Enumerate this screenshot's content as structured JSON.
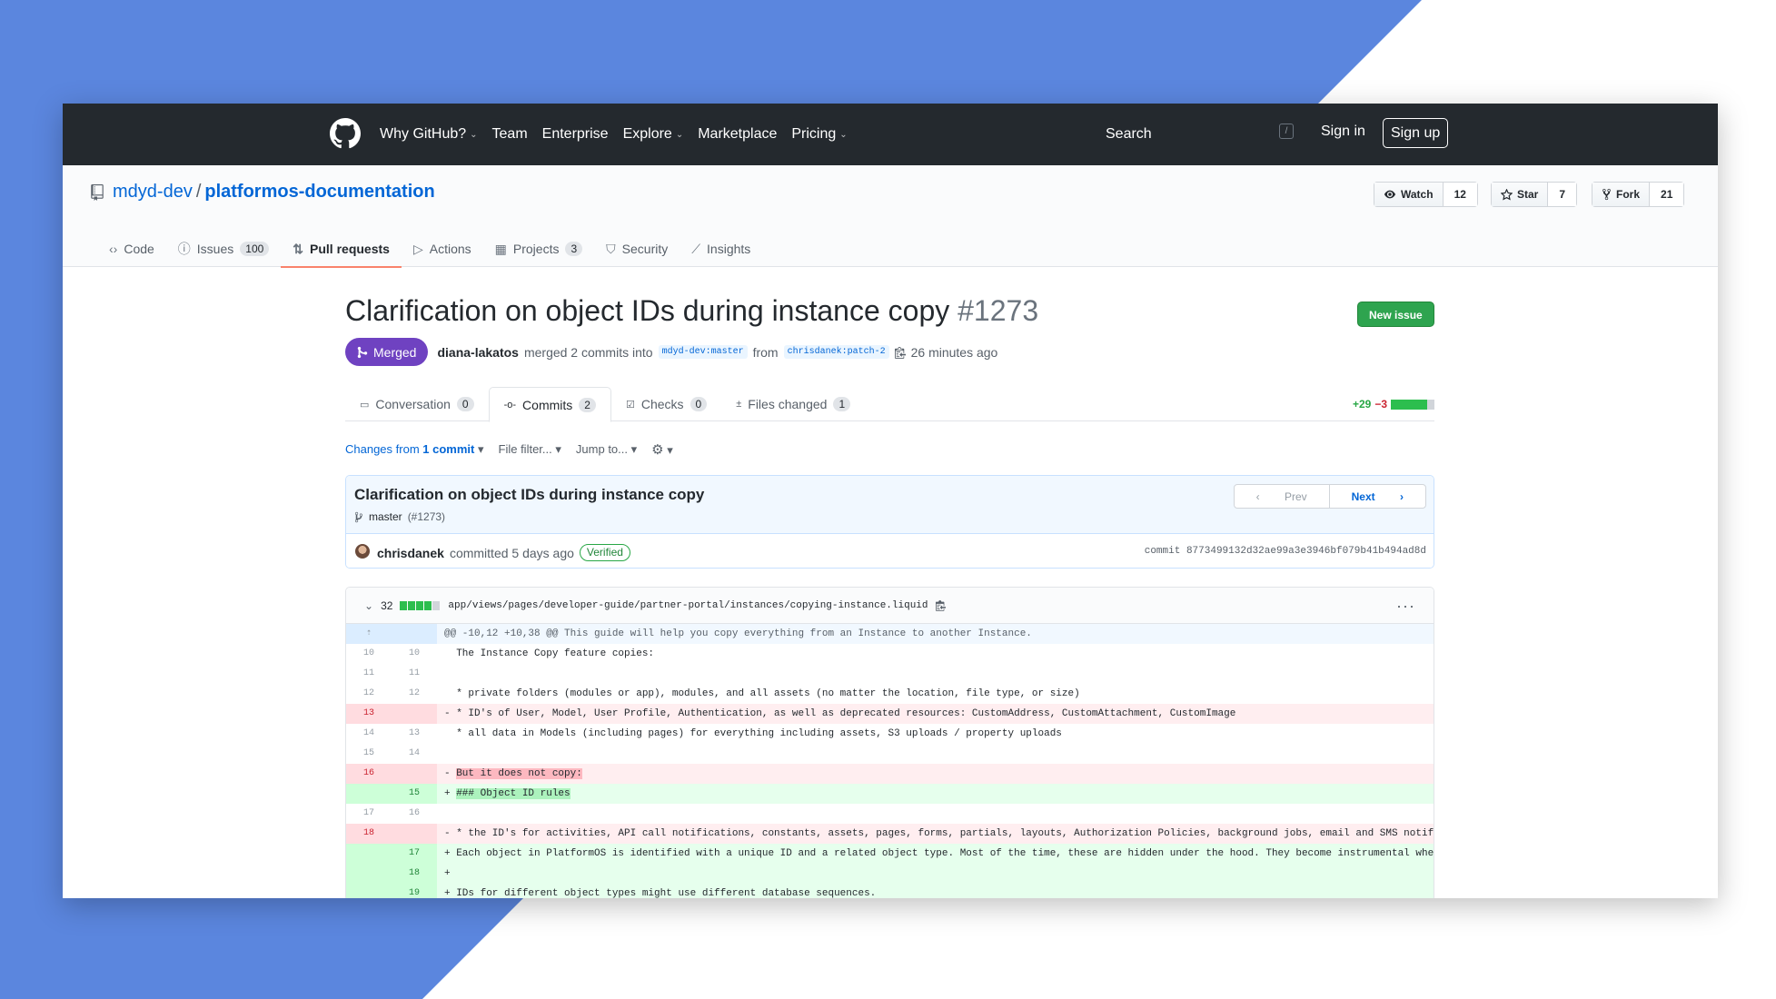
{
  "nav": {
    "links": [
      {
        "label": "Why GitHub?",
        "chevron": true
      },
      {
        "label": "Team",
        "chevron": false
      },
      {
        "label": "Enterprise",
        "chevron": false
      },
      {
        "label": "Explore",
        "chevron": true
      },
      {
        "label": "Marketplace",
        "chevron": false
      },
      {
        "label": "Pricing",
        "chevron": true
      }
    ],
    "search_placeholder": "Search",
    "slash_key": "/",
    "sign_in": "Sign in",
    "sign_up": "Sign up"
  },
  "repo": {
    "owner": "mdyd-dev",
    "separator": "/",
    "name": "platformos-documentation",
    "watch": {
      "label": "Watch",
      "count": "12"
    },
    "star": {
      "label": "Star",
      "count": "7"
    },
    "fork": {
      "label": "Fork",
      "count": "21"
    },
    "tabs": [
      {
        "label": "Code",
        "icon": "code-icon",
        "count": ""
      },
      {
        "label": "Issues",
        "icon": "issue-icon",
        "count": "100"
      },
      {
        "label": "Pull requests",
        "icon": "pull-request-icon",
        "count": "",
        "selected": true
      },
      {
        "label": "Actions",
        "icon": "play-icon",
        "count": ""
      },
      {
        "label": "Projects",
        "icon": "project-icon",
        "count": "3"
      },
      {
        "label": "Security",
        "icon": "shield-icon",
        "count": ""
      },
      {
        "label": "Insights",
        "icon": "graph-icon",
        "count": ""
      }
    ]
  },
  "pr": {
    "title": "Clarification on object IDs during instance copy",
    "number": "#1273",
    "new_issue": "New issue",
    "state": "Merged",
    "author": "diana-lakatos",
    "merge_text": "merged 2 commits into",
    "base_branch": "mdyd-dev:master",
    "from_text": "from",
    "head_branch": "chrisdanek:patch-2",
    "time": "26 minutes ago",
    "tabs": [
      {
        "label": "Conversation",
        "count": "0",
        "icon": "comment-icon"
      },
      {
        "label": "Commits",
        "count": "2",
        "icon": "commit-icon",
        "selected": true
      },
      {
        "label": "Checks",
        "count": "0",
        "icon": "checklist-icon"
      },
      {
        "label": "Files changed",
        "count": "1",
        "icon": "file-diff-icon"
      }
    ],
    "diffstat_add": "+29",
    "diffstat_del": "−3"
  },
  "toolbar": {
    "changes_prefix": "Changes from",
    "changes_link": "1 commit",
    "file_filter": "File filter...",
    "jump_to": "Jump to..."
  },
  "commit": {
    "title": "Clarification on object IDs during instance copy",
    "branch": "master",
    "pr_ref": "(#1273)",
    "prev": "Prev",
    "next": "Next",
    "author": "chrisdanek",
    "committed": "committed 5 days ago",
    "verified": "Verified",
    "sha": "commit 8773499132d32ae99a3e3946bf079b41b494ad8d"
  },
  "file": {
    "changes": "32",
    "path": "app/views/pages/developer-guide/partner-portal/instances/copying-instance.liquid"
  },
  "diff": [
    {
      "type": "hunk",
      "l1": "",
      "l2": "",
      "code": "@@ -10,12 +10,38 @@ This guide will help you copy everything from an Instance to another Instance."
    },
    {
      "type": "ctx",
      "l1": "10",
      "l2": "10",
      "code": "  The Instance Copy feature copies:"
    },
    {
      "type": "ctx",
      "l1": "11",
      "l2": "11",
      "code": ""
    },
    {
      "type": "ctx",
      "l1": "12",
      "l2": "12",
      "code": "  * private folders (modules or app), modules, and all assets (no matter the location, file type, or size)"
    },
    {
      "type": "del",
      "l1": "13",
      "l2": "",
      "code": "- * ID's of User, Model, User Profile, Authentication, as well as deprecated resources: CustomAddress, CustomAttachment, CustomImage"
    },
    {
      "type": "ctx",
      "l1": "14",
      "l2": "13",
      "code": "  * all data in Models (including pages) for everything including assets, S3 uploads / property uploads"
    },
    {
      "type": "ctx",
      "l1": "15",
      "l2": "14",
      "code": ""
    },
    {
      "type": "del",
      "l1": "16",
      "l2": "",
      "code": "- ",
      "hl": "But it does not copy:"
    },
    {
      "type": "add",
      "l1": "",
      "l2": "15",
      "code": "+ ",
      "hl": "### Object ID rules"
    },
    {
      "type": "ctx",
      "l1": "17",
      "l2": "16",
      "code": ""
    },
    {
      "type": "del",
      "l1": "18",
      "l2": "",
      "code": "- * the ID's for activities, API call notifications, constants, assets, pages, forms, partials, layouts, Authorization Policies, background jobs, email and SMS notifications"
    },
    {
      "type": "add",
      "l1": "",
      "l2": "17",
      "code": "+ Each object in PlatformOS is identified with a unique ID and a related object type. Most of the time, these are hidden under the hood. They become instrumental when building"
    },
    {
      "type": "add",
      "l1": "",
      "l2": "18",
      "code": "+"
    },
    {
      "type": "add",
      "l1": "",
      "l2": "19",
      "code": "+ IDs for different object types might use different database sequences."
    }
  ],
  "colors": {
    "background": "#5b86de",
    "header": "#24292e",
    "merged": "#6f42c1",
    "accent": "#0366d6",
    "green": "#2ea44f"
  }
}
